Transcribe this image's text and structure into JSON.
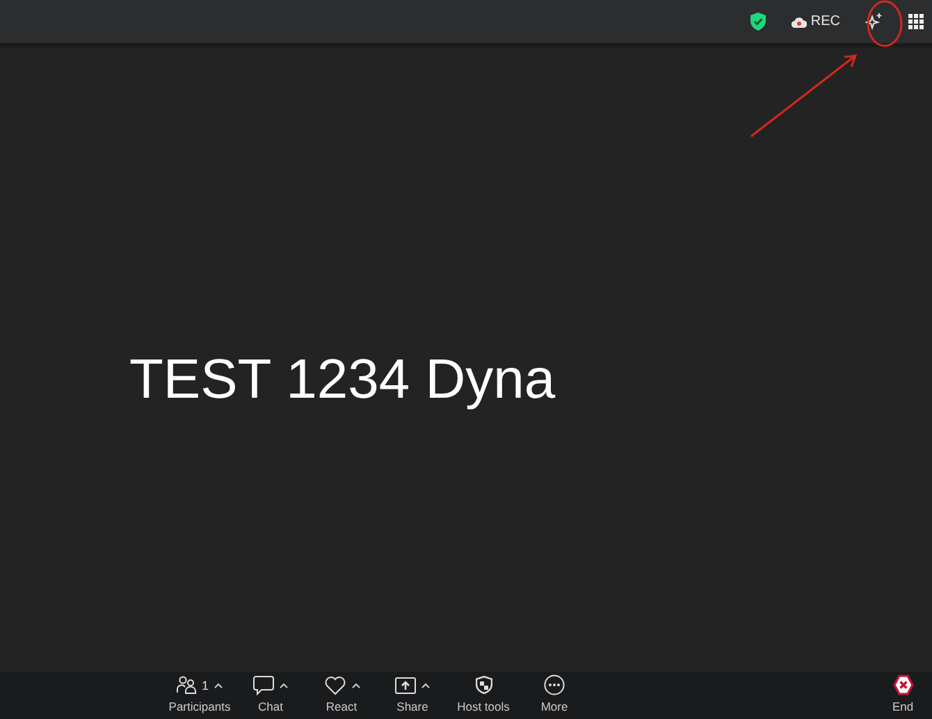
{
  "top_bar": {
    "rec_label": "REC"
  },
  "shared_screen": {
    "text": "TEST 1234 Dyna"
  },
  "toolbar": [
    {
      "kind": "participants",
      "label": "Participants",
      "count": "1",
      "has_menu": true
    },
    {
      "kind": "chat",
      "label": "Chat",
      "has_menu": true
    },
    {
      "kind": "react",
      "label": "React",
      "has_menu": true
    },
    {
      "kind": "share",
      "label": "Share",
      "has_menu": true
    },
    {
      "kind": "host",
      "label": "Host tools",
      "has_menu": false
    },
    {
      "kind": "more",
      "label": "More",
      "has_menu": false
    }
  ],
  "end_button": {
    "label": "End"
  }
}
